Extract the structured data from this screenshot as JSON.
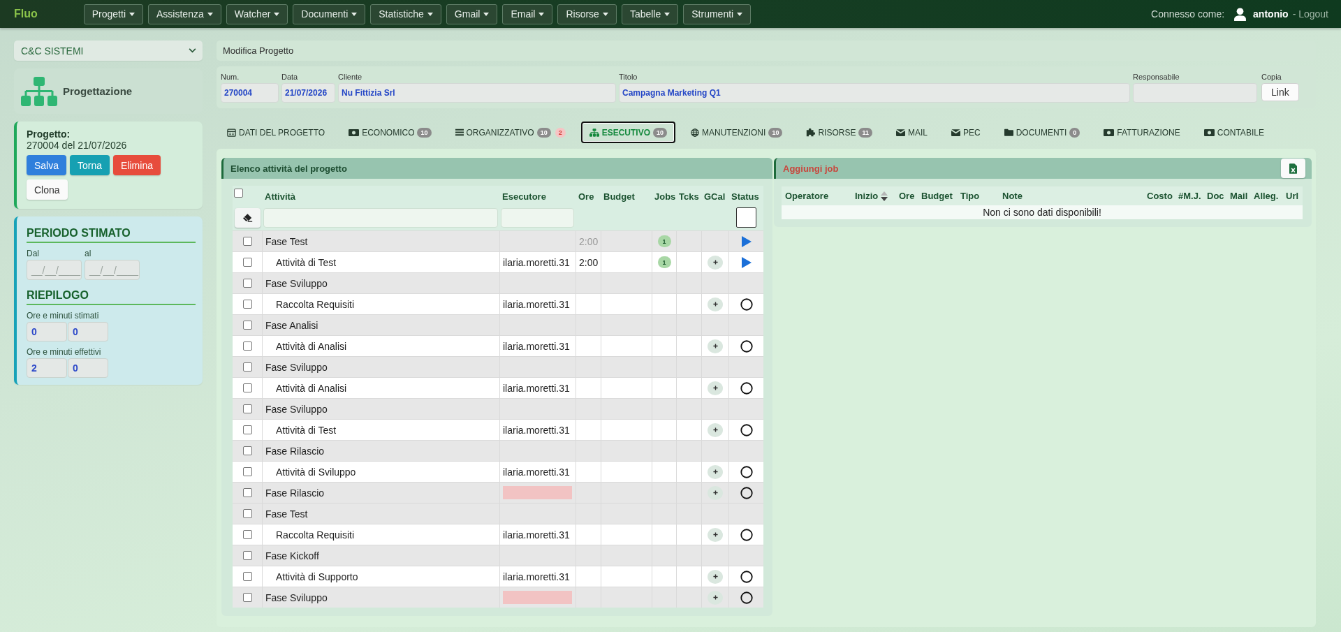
{
  "navbar": {
    "brand": "Fluo",
    "menus": [
      "Progetti",
      "Assistenza",
      "Watcher",
      "Documenti",
      "Statistiche",
      "Gmail",
      "Email",
      "Risorse",
      "Tabelle",
      "Strumenti"
    ],
    "user_label": "Connesso come:",
    "username": "antonio",
    "logout": "- Logout"
  },
  "sidebar": {
    "company_select": {
      "value": "C&C SISTEMI"
    },
    "module": {
      "title": "Progettazione"
    },
    "project": {
      "label": "Progetto:",
      "subtitle": "270004 del 21/07/2026",
      "buttons": [
        {
          "label": "Salva",
          "kind": "primary"
        },
        {
          "label": "Torna",
          "kind": "info"
        },
        {
          "label": "Elimina",
          "kind": "danger"
        },
        {
          "label": "Clona",
          "kind": "default"
        }
      ]
    },
    "period": {
      "title": "PERIODO STIMATO",
      "fields": [
        {
          "label": "Dal",
          "placeholder": "__/__/____"
        },
        {
          "label": "al",
          "placeholder": "__/__/____"
        }
      ]
    },
    "summary": {
      "title": "RIEPILOGO",
      "groups": [
        {
          "label": "Ore e minuti stimati",
          "values": [
            "0",
            "0"
          ]
        },
        {
          "label": "Ore e minuti effettivi",
          "values": [
            "2",
            "0"
          ]
        }
      ]
    }
  },
  "breadcrumb": "Modifica Progetto",
  "project_form": {
    "fields": [
      {
        "label": "Num.",
        "value": "270004"
      },
      {
        "label": "Data",
        "value": "21/07/2026"
      },
      {
        "label": "Cliente",
        "value": "Nu Fittizia Srl"
      },
      {
        "label": "Titolo",
        "value": "Campagna Marketing Q1"
      },
      {
        "label": "Responsabile"
      }
    ],
    "copy": {
      "label": "Copia",
      "button": "Link"
    }
  },
  "tabs": [
    {
      "label": "DATI DEL PROGETTO",
      "selected": false
    },
    {
      "label": "ECONOMICO",
      "count": "10",
      "selected": false
    },
    {
      "label": "ORGANIZZATIVO",
      "count": "10",
      "alert": "2",
      "selected": false
    },
    {
      "label": "ESECUTIVO",
      "count": "10",
      "selected": true
    },
    {
      "label": "MANUTENZIONI",
      "count": "10",
      "selected": false
    },
    {
      "label": "RISORSE",
      "count": "11",
      "selected": false
    },
    {
      "label": "MAIL",
      "selected": false
    },
    {
      "label": "PEC",
      "selected": false
    },
    {
      "label": "DOCUMENTI",
      "count": "0",
      "selected": false
    },
    {
      "label": "FATTURAZIONE",
      "selected": false
    },
    {
      "label": "CONTABILE",
      "selected": false
    }
  ],
  "activities": {
    "title": "Elenco attività del progetto",
    "select_all": {
      "checked": false
    },
    "columns": [
      "Attività",
      "Esecutore",
      "Ore",
      "Budget",
      "Jobs",
      "Tcks",
      "GCal",
      "Status"
    ],
    "rows": [
      {
        "kind": "phase",
        "name": "Fase Test",
        "hours": "2:00",
        "jobs": "1",
        "started": true,
        "checked": false,
        "executor_missing": false,
        "calendar_button": false
      },
      {
        "kind": "task",
        "name": "Attività di Test",
        "executor": "ilaria.moretti.31",
        "hours": "2:00",
        "jobs": "1",
        "started": true,
        "checked": false,
        "executor_missing": false,
        "calendar_button": true
      },
      {
        "kind": "phase",
        "name": "Fase Sviluppo",
        "checked": false,
        "executor_missing": false,
        "calendar_button": false
      },
      {
        "kind": "task",
        "name": "Raccolta Requisiti",
        "executor": "ilaria.moretti.31",
        "started": false,
        "checked": false,
        "executor_missing": false,
        "calendar_button": true
      },
      {
        "kind": "phase",
        "name": "Fase Analisi",
        "checked": false,
        "executor_missing": false,
        "calendar_button": false
      },
      {
        "kind": "task",
        "name": "Attività di Analisi",
        "executor": "ilaria.moretti.31",
        "started": false,
        "checked": false,
        "executor_missing": false,
        "calendar_button": true
      },
      {
        "kind": "phase",
        "name": "Fase Sviluppo",
        "checked": false,
        "executor_missing": false,
        "calendar_button": false
      },
      {
        "kind": "task",
        "name": "Attività di Analisi",
        "executor": "ilaria.moretti.31",
        "started": false,
        "checked": false,
        "executor_missing": false,
        "calendar_button": true
      },
      {
        "kind": "phase",
        "name": "Fase Sviluppo",
        "checked": false,
        "executor_missing": false,
        "calendar_button": false
      },
      {
        "kind": "task",
        "name": "Attività di Test",
        "executor": "ilaria.moretti.31",
        "started": false,
        "checked": false,
        "executor_missing": false,
        "calendar_button": true
      },
      {
        "kind": "phase",
        "name": "Fase Rilascio",
        "checked": false,
        "executor_missing": false,
        "calendar_button": false
      },
      {
        "kind": "task",
        "name": "Attività di Sviluppo",
        "executor": "ilaria.moretti.31",
        "started": false,
        "checked": false,
        "executor_missing": false,
        "calendar_button": true
      },
      {
        "kind": "phase",
        "name": "Fase Rilascio",
        "started": false,
        "checked": false,
        "executor_missing": true,
        "calendar_button": true
      },
      {
        "kind": "phase",
        "name": "Fase Test",
        "checked": false,
        "executor_missing": false,
        "calendar_button": false
      },
      {
        "kind": "task",
        "name": "Raccolta Requisiti",
        "executor": "ilaria.moretti.31",
        "started": false,
        "checked": false,
        "executor_missing": false,
        "calendar_button": true
      },
      {
        "kind": "phase",
        "name": "Fase Kickoff",
        "checked": false,
        "executor_missing": false,
        "calendar_button": false
      },
      {
        "kind": "task",
        "name": "Attività di Supporto",
        "executor": "ilaria.moretti.31",
        "started": false,
        "checked": false,
        "executor_missing": false,
        "calendar_button": true
      },
      {
        "kind": "phase",
        "name": "Fase Sviluppo",
        "started": false,
        "checked": false,
        "executor_missing": true,
        "calendar_button": true
      }
    ]
  },
  "jobs": {
    "title": "Aggiungi job",
    "columns": [
      {
        "label": "Operatore"
      },
      {
        "label": "Inizio",
        "sort_descending": true
      },
      {
        "label": "Ore"
      },
      {
        "label": "Budget"
      },
      {
        "label": "Tipo"
      },
      {
        "label": "Note"
      },
      {
        "label": "Costo"
      },
      {
        "label": "#M.J."
      },
      {
        "label": "Doc"
      },
      {
        "label": "Mail"
      },
      {
        "label": "Alleg."
      },
      {
        "label": "Url"
      }
    ],
    "empty_message": "Non ci sono dati disponibili!"
  }
}
